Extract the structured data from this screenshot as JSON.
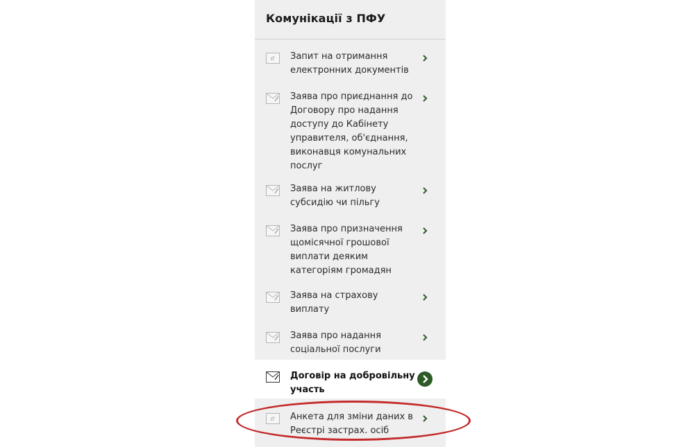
{
  "panel": {
    "title": "Комунікації з ПФУ"
  },
  "items": [
    {
      "label": "Запит на отримання електронних документів",
      "icon": "doc-icon",
      "active": false
    },
    {
      "label": "Заява про приєднання до Договору про надання доступу до Кабінету управителя, об'єднання, виконавця комунальних послуг",
      "icon": "envelope-icon",
      "active": false
    },
    {
      "label": "Заява на житлову субсидію чи пільгу",
      "icon": "envelope-icon",
      "active": false
    },
    {
      "label": "Заява про призначення щомісячної грошової виплати деяким категоріям громадян",
      "icon": "envelope-icon",
      "active": false
    },
    {
      "label": "Заява на страхову виплату",
      "icon": "envelope-icon",
      "active": false
    },
    {
      "label": "Заява про надання соціальної послуги",
      "icon": "envelope-icon",
      "active": false
    },
    {
      "label": "Договір на добровільну участь",
      "icon": "envelope-icon",
      "active": true
    },
    {
      "label": "Анкета для зміни даних в Реєстрі застрах. осіб",
      "icon": "doc-icon",
      "active": false
    }
  ],
  "colors": {
    "accent": "#2d5a27",
    "panel_bg": "#efeff0",
    "highlight_ellipse": "#c42a2a"
  }
}
